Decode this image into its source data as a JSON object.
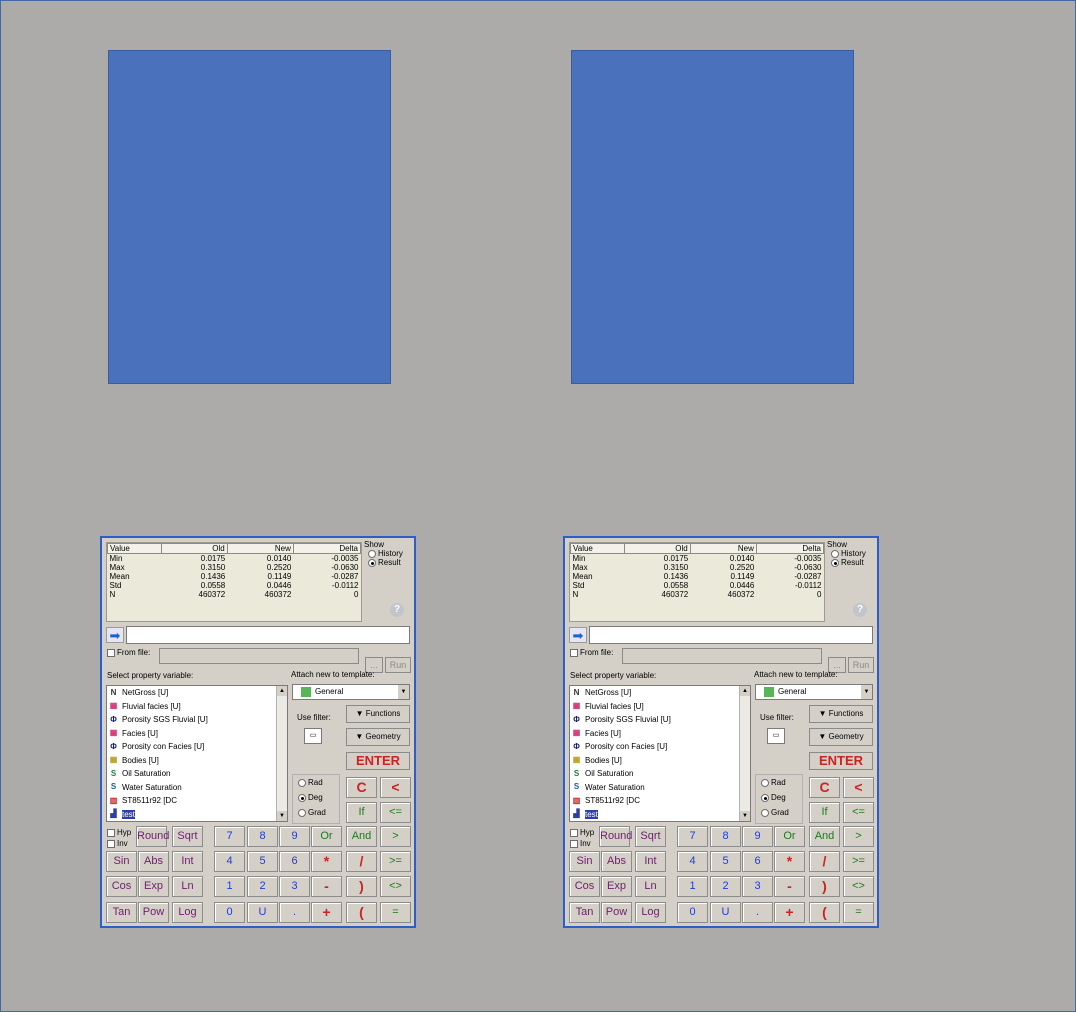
{
  "calculator": {
    "stats": {
      "headers": [
        "Value",
        "Old",
        "New",
        "Delta"
      ],
      "rows": [
        [
          "Min",
          "0.0175",
          "0.0140",
          "-0.0035"
        ],
        [
          "Max",
          "0.3150",
          "0.2520",
          "-0.0630"
        ],
        [
          "Mean",
          "0.1436",
          "0.1149",
          "-0.0287"
        ],
        [
          "Std",
          "0.0558",
          "0.0446",
          "-0.0112"
        ],
        [
          "N",
          "460372",
          "460372",
          "0"
        ]
      ]
    },
    "show": {
      "label": "Show",
      "history": "History",
      "result": "Result",
      "selected": "Result"
    },
    "help_glyph": "?",
    "from_file": {
      "label": "From file:",
      "browse": "...",
      "run": "Run"
    },
    "select_label": "Select property variable:",
    "attach_label": "Attach new to template:",
    "template_value": "General",
    "use_filter_label": "Use filter:",
    "functions_label": "Functions",
    "geometry_label": "Geometry",
    "enter_label": "ENTER",
    "modes": {
      "rad": "Rad",
      "deg": "Deg",
      "grad": "Grad",
      "selected": "Deg"
    },
    "hyp": "Hyp",
    "inv": "Inv",
    "properties": [
      {
        "label": "NetGross [U]",
        "icon": "netgross-icon",
        "glyph": "N",
        "color": "#333333"
      },
      {
        "label": "Fluvial facies [U]",
        "icon": "facies-icon",
        "glyph": "▦",
        "color": "#d03070"
      },
      {
        "label": "Porosity SGS Fluvial [U]",
        "icon": "phi-icon",
        "glyph": "Φ",
        "color": "#1a1a6e"
      },
      {
        "label": "Facies [U]",
        "icon": "facies-icon",
        "glyph": "▦",
        "color": "#d03070"
      },
      {
        "label": "Porosity con Facies [U]",
        "icon": "phi-icon",
        "glyph": "Φ",
        "color": "#1a1a6e"
      },
      {
        "label": "Bodies [U]",
        "icon": "bodies-icon",
        "glyph": "▦",
        "color": "#b8a020"
      },
      {
        "label": "Oil Saturation",
        "icon": "saturation-icon",
        "glyph": "S",
        "color": "#1d7a3a"
      },
      {
        "label": "Water Saturation",
        "icon": "saturation-icon",
        "glyph": "S",
        "color": "#1d5a9a"
      },
      {
        "label": "ST8511r92 [DC",
        "icon": "well-log-icon",
        "glyph": "▥",
        "color": "#c02020"
      },
      {
        "label": "test",
        "icon": "test-icon",
        "glyph": "▟",
        "color": "#2d3fa5"
      }
    ],
    "keys": {
      "row1": [
        "Round",
        "Sqrt",
        "7",
        "8",
        "9",
        "Or",
        "And",
        ">"
      ],
      "row2": [
        "Sin",
        "Abs",
        "Int",
        "4",
        "5",
        "6",
        "*",
        "/",
        ">="
      ],
      "row3": [
        "Cos",
        "Exp",
        "Ln",
        "1",
        "2",
        "3",
        "-",
        ")",
        "<>"
      ],
      "row4": [
        "Tan",
        "Pow",
        "Log",
        "0",
        "U",
        ".",
        "+",
        "(",
        "="
      ],
      "c": "C",
      "lt": "<",
      "if": "If",
      "le": "<="
    }
  }
}
